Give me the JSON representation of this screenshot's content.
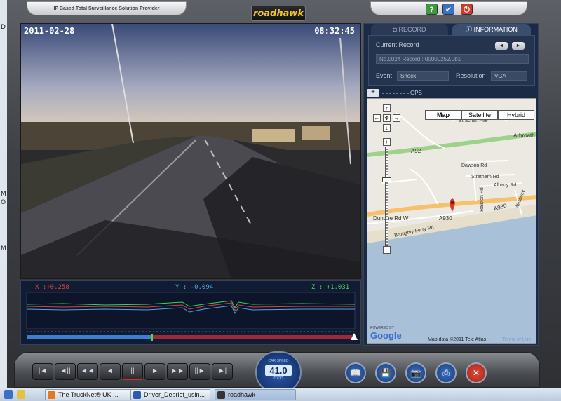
{
  "header": {
    "tagline": "IP Based Total Surveillance Solution Provider",
    "logo_text": "roadhawk",
    "buttons": [
      {
        "icon": "help-icon",
        "label": "?",
        "color": "#3e9a3a"
      },
      {
        "icon": "minimize-icon",
        "label": "↙",
        "color": "#3a6fc4"
      },
      {
        "icon": "power-icon",
        "label": "⏻",
        "color": "#d23a2a"
      }
    ]
  },
  "video": {
    "date": "2011-02-28",
    "time": "08:32:45"
  },
  "graph": {
    "x_label": "X  :+0.258",
    "y_label": "Y  : -0.094",
    "z_label": "Z  : +1.031",
    "colors": {
      "x": "#e04040",
      "y": "#4aa8e8",
      "z": "#40d060"
    }
  },
  "tabs": {
    "record": "RECORD",
    "information": "INFORMATION"
  },
  "info": {
    "current_record_label": "Current Record",
    "current_record_value": "No.0024 Record : 00000252.ub1",
    "event_label": "Event",
    "event_value": "Shock",
    "resolution_label": "Resolution",
    "resolution_value": "VGA",
    "gps_label": "GPS",
    "gps_expand": "+",
    "prev": "◄",
    "next": "►"
  },
  "map": {
    "types": [
      "Map",
      "Satellite",
      "Hybrid"
    ],
    "selected_type": "Map",
    "roads": {
      "a92": "A92",
      "arbroath": "Arbroath",
      "a930_a": "A930",
      "a930_b": "A930",
      "dundee": "Dundee Rd W",
      "broughty": "Broughty Ferry Rd",
      "strachan": "Strachan Ave",
      "dawson": "Dawson Rd",
      "strathern": "Strathern Rd",
      "albany": "Albany Rd",
      "ralston": "Ralston Rd",
      "westway": "Westway"
    },
    "powered_by": "POWERED BY",
    "google": "Google",
    "attribution": "Map data ©2011 Tele Atlas - ",
    "terms": "Terms of Use",
    "zoom_in": "+",
    "zoom_out": "−"
  },
  "playback": {
    "buttons": [
      {
        "icon": "skip-start-icon",
        "label": "|◄"
      },
      {
        "icon": "step-back-icon",
        "label": "◄||"
      },
      {
        "icon": "rewind-icon",
        "label": "◄◄"
      },
      {
        "icon": "play-reverse-icon",
        "label": "◄"
      },
      {
        "icon": "pause-icon",
        "label": "||"
      },
      {
        "icon": "play-icon",
        "label": "►"
      },
      {
        "icon": "fast-forward-icon",
        "label": "►►"
      },
      {
        "icon": "step-forward-icon",
        "label": "||►"
      },
      {
        "icon": "skip-end-icon",
        "label": "►|"
      }
    ],
    "speed_caption": "CAR SPEED",
    "speed_value": "41.0",
    "speed_unit": "mph",
    "right_buttons": [
      {
        "icon": "open-book-icon",
        "label": "📖"
      },
      {
        "icon": "save-icon",
        "label": "💾"
      },
      {
        "icon": "camera-icon",
        "label": "📷"
      },
      {
        "icon": "print-icon",
        "label": "⎙"
      },
      {
        "icon": "settings-icon",
        "label": "✕"
      }
    ],
    "progress": 0.38
  },
  "taskbar": {
    "items": [
      {
        "label": "The TruckNet® UK ...",
        "color": "#e07a1c"
      },
      {
        "label": "Driver_Debrief_usin...",
        "color": "#2a5bb0"
      },
      {
        "label": "roadhawk",
        "color": "#333333"
      }
    ]
  },
  "desktop": {
    "left_chars": [
      "D",
      "M",
      "O",
      "M"
    ]
  }
}
